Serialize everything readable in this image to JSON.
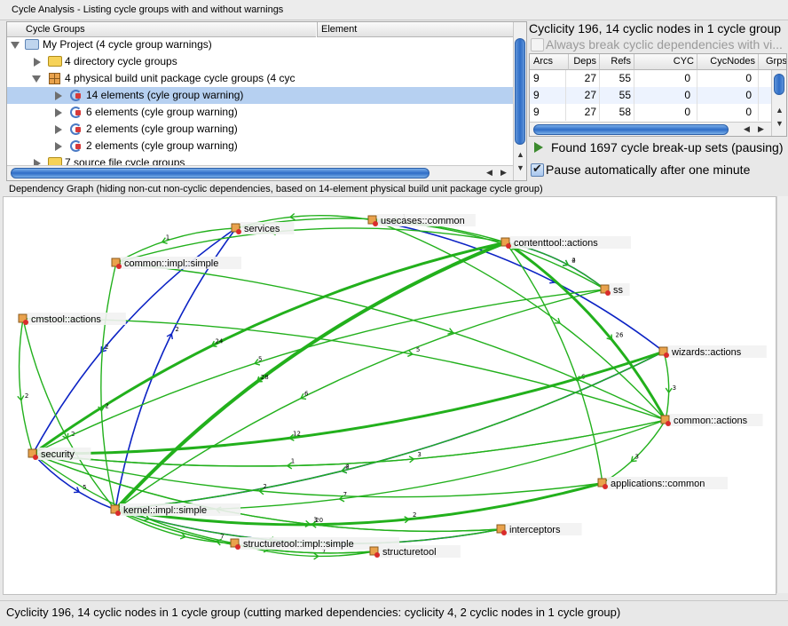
{
  "window_title": "Cycle Analysis - Listing cycle groups with and without warnings",
  "tree": {
    "col_groups": "Cycle Groups",
    "col_element": "Element",
    "rows": [
      {
        "label": "My Project (4 cycle group warnings)",
        "icon": "folder-open-icon"
      },
      {
        "label": "4 directory cycle groups",
        "icon": "folder-icon"
      },
      {
        "label": "4 physical build unit package cycle groups (4 cyc",
        "icon": "package-icon"
      },
      {
        "label": "14 elements (cyle group warning)",
        "icon": "cycle-group-icon"
      },
      {
        "label": "6 elements (cyle group warning)",
        "icon": "cycle-group-icon"
      },
      {
        "label": "2 elements (cyle group warning)",
        "icon": "cycle-group-icon"
      },
      {
        "label": "2 elements (cyle group warning)",
        "icon": "cycle-group-icon"
      },
      {
        "label": "7 source file cycle groups",
        "icon": "folder-icon"
      }
    ]
  },
  "right_panel": {
    "title": "Cyclicity 196, 14 cyclic nodes in 1 cycle group",
    "always_break_label": "Always break cyclic dependencies with vi...",
    "table": {
      "headers": [
        "Arcs",
        "Deps",
        "Refs",
        "CYC",
        "CycNodes",
        "Grps"
      ],
      "rows": [
        [
          "9",
          "27",
          "55",
          "0",
          "0",
          ""
        ],
        [
          "9",
          "27",
          "55",
          "0",
          "0",
          ""
        ],
        [
          "9",
          "27",
          "58",
          "0",
          "0",
          ""
        ]
      ]
    },
    "found_label": "Found 1697 cycle break-up sets (pausing)",
    "pause_label": "Pause automatically after one minute"
  },
  "graph_title": "Dependency Graph (hiding non-cut non-cyclic dependencies, based on 14-element physical build unit package cycle group)",
  "graph": {
    "colors": {
      "cut": "#0b22c4",
      "kept": "#22b01c"
    },
    "nodes": [
      {
        "id": "services",
        "label": "services"
      },
      {
        "id": "usecases",
        "label": "usecases::common"
      },
      {
        "id": "common_impl",
        "label": "common::impl::simple"
      },
      {
        "id": "contenttool",
        "label": "contenttool::actions"
      },
      {
        "id": "ss",
        "label": "ss"
      },
      {
        "id": "cmstool",
        "label": "cmstool::actions"
      },
      {
        "id": "wizards",
        "label": "wizards::actions"
      },
      {
        "id": "common_actions",
        "label": "common::actions"
      },
      {
        "id": "security",
        "label": "security"
      },
      {
        "id": "appcommon",
        "label": "applications::common"
      },
      {
        "id": "kernel",
        "label": "kernel::impl::simple"
      },
      {
        "id": "interceptors",
        "label": "interceptors"
      },
      {
        "id": "structuretool_impl",
        "label": "structuretool::impl::simple"
      },
      {
        "id": "structuretool",
        "label": "structuretool"
      }
    ],
    "edges": [
      {
        "from": "services",
        "to": "security",
        "cut": true,
        "label": "2"
      },
      {
        "from": "kernel",
        "to": "services",
        "cut": true,
        "label": "2"
      },
      {
        "from": "wizards",
        "to": "kernel",
        "cut": true,
        "label": "2"
      },
      {
        "from": "contenttool",
        "to": "ss",
        "cut": true,
        "label": "2"
      },
      {
        "from": "security",
        "to": "kernel",
        "cut": true,
        "label": "5"
      },
      {
        "from": "kernel",
        "to": "interceptors",
        "cut": true,
        "label": ""
      },
      {
        "from": "usecases",
        "to": "wizards",
        "cut": true,
        "label": ""
      },
      {
        "from": "contenttool",
        "to": "kernel",
        "cut": false,
        "label": "28"
      },
      {
        "from": "contenttool",
        "to": "security",
        "cut": false,
        "label": "24"
      },
      {
        "from": "contenttool",
        "to": "common_actions",
        "cut": false,
        "label": "26"
      },
      {
        "from": "contenttool",
        "to": "ss",
        "cut": false,
        "label": "4"
      },
      {
        "from": "contenttool",
        "to": "appcommon",
        "cut": false,
        "label": "6"
      },
      {
        "from": "contenttool",
        "to": "common_impl",
        "cut": false,
        "label": "1"
      },
      {
        "from": "usecases",
        "to": "services",
        "cut": false,
        "label": ""
      },
      {
        "from": "usecases",
        "to": "ss",
        "cut": false,
        "label": ""
      },
      {
        "from": "usecases",
        "to": "common_actions",
        "cut": false,
        "label": ""
      },
      {
        "from": "common_impl",
        "to": "kernel",
        "cut": false,
        "label": "2"
      },
      {
        "from": "common_impl",
        "to": "common_actions",
        "cut": false,
        "label": ""
      },
      {
        "from": "cmstool",
        "to": "security",
        "cut": false,
        "label": "2"
      },
      {
        "from": "cmstool",
        "to": "common_actions",
        "cut": false,
        "label": "5"
      },
      {
        "from": "cmstool",
        "to": "kernel",
        "cut": false,
        "label": "2"
      },
      {
        "from": "services",
        "to": "common_impl",
        "cut": false,
        "label": "1"
      },
      {
        "from": "services",
        "to": "contenttool",
        "cut": false,
        "label": "1"
      },
      {
        "from": "wizards",
        "to": "security",
        "cut": false,
        "label": "12"
      },
      {
        "from": "wizards",
        "to": "common_actions",
        "cut": false,
        "label": "3"
      },
      {
        "from": "wizards",
        "to": "kernel",
        "cut": false,
        "label": "4"
      },
      {
        "from": "ss",
        "to": "security",
        "cut": false,
        "label": "5"
      },
      {
        "from": "ss",
        "to": "kernel",
        "cut": false,
        "label": "6"
      },
      {
        "from": "common_actions",
        "to": "appcommon",
        "cut": false,
        "label": "3"
      },
      {
        "from": "common_actions",
        "to": "security",
        "cut": false,
        "label": "1"
      },
      {
        "from": "common_actions",
        "to": "kernel",
        "cut": false,
        "label": "7"
      },
      {
        "from": "security",
        "to": "common_actions",
        "cut": false,
        "label": "3"
      },
      {
        "from": "security",
        "to": "structuretool_impl",
        "cut": false,
        "label": "3"
      },
      {
        "from": "security",
        "to": "interceptors",
        "cut": false,
        "label": "3"
      },
      {
        "from": "appcommon",
        "to": "kernel",
        "cut": false,
        "label": "20"
      },
      {
        "from": "appcommon",
        "to": "security",
        "cut": false,
        "label": "2"
      },
      {
        "from": "interceptors",
        "to": "kernel",
        "cut": false,
        "label": ""
      },
      {
        "from": "interceptors",
        "to": "security",
        "cut": false,
        "label": ""
      },
      {
        "from": "structuretool_impl",
        "to": "structuretool",
        "cut": false,
        "label": "7"
      },
      {
        "from": "structuretool",
        "to": "kernel",
        "cut": false,
        "label": "7"
      },
      {
        "from": "kernel",
        "to": "structuretool_impl",
        "cut": false,
        "label": ""
      },
      {
        "from": "kernel",
        "to": "appcommon",
        "cut": false,
        "label": "2"
      },
      {
        "from": "kernel",
        "to": "structuretool",
        "cut": false,
        "label": "3"
      }
    ]
  },
  "status_text": "Cyclicity 196, 14 cyclic nodes in 1 cycle group (cutting marked dependencies: cyclicity 4, 2 cyclic nodes in 1 cycle group)"
}
